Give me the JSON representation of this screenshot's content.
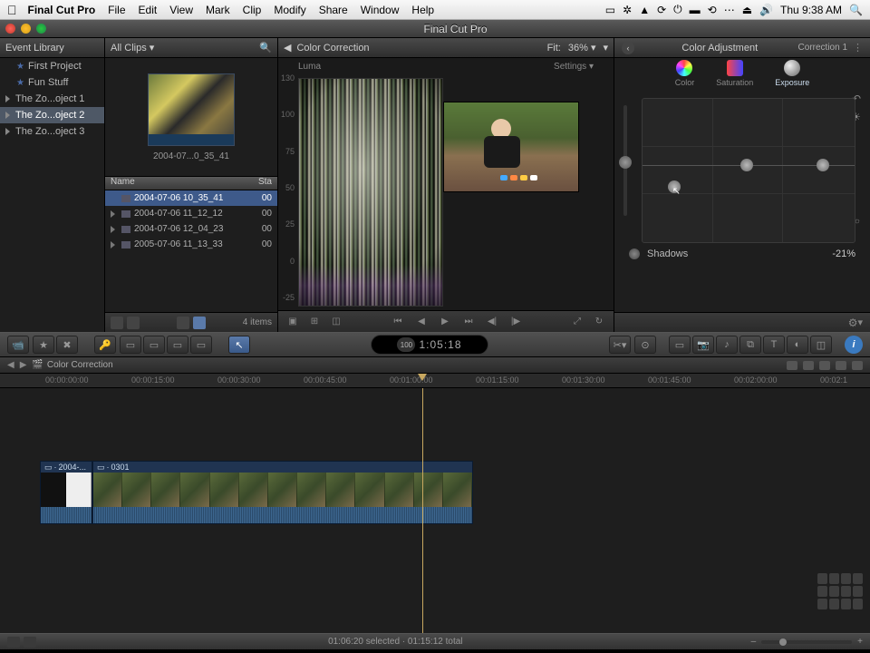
{
  "menubar": {
    "app": "Final Cut Pro",
    "items": [
      "File",
      "Edit",
      "View",
      "Mark",
      "Clip",
      "Modify",
      "Share",
      "Window",
      "Help"
    ],
    "clock": "Thu 9:38 AM"
  },
  "window_title": "Final Cut Pro",
  "event_library": {
    "title": "Event Library",
    "items": [
      {
        "label": "First Project",
        "kind": "star"
      },
      {
        "label": "Fun Stuff",
        "kind": "star"
      },
      {
        "label": "The Zo...oject 1",
        "kind": "tri"
      },
      {
        "label": "The Zo...oject 2",
        "kind": "tri",
        "selected": true
      },
      {
        "label": "The Zo...oject 3",
        "kind": "tri"
      }
    ]
  },
  "browser": {
    "filter": "All Clips",
    "thumb_label": "2004-07...0_35_41",
    "list_header": {
      "name": "Name",
      "start": "Sta"
    },
    "rows": [
      {
        "name": "2004-07-06 10_35_41",
        "start": "00",
        "selected": true
      },
      {
        "name": "2004-07-06 11_12_12",
        "start": "00"
      },
      {
        "name": "2004-07-06 12_04_23",
        "start": "00"
      },
      {
        "name": "2005-07-06 11_13_33",
        "start": "00"
      }
    ],
    "footer": "4 items"
  },
  "viewer": {
    "title": "Color Correction",
    "fit_label": "Fit:",
    "fit_value": "36%",
    "scope_label": "Luma",
    "settings_label": "Settings",
    "axis_ticks": [
      "130",
      "100",
      "75",
      "50",
      "25",
      "0",
      "-25"
    ]
  },
  "inspector": {
    "title": "Color Adjustment",
    "sub": "Correction 1",
    "tabs": {
      "color": "Color",
      "saturation": "Saturation",
      "exposure": "Exposure"
    },
    "param_label": "Shadows",
    "param_value": "-21%"
  },
  "timecode": {
    "badge": "100",
    "value": "1:05:18"
  },
  "timeline": {
    "title": "Color Correction",
    "ruler": [
      "00:00:00:00",
      "00:00:15:00",
      "00:00:30:00",
      "00:00:45:00",
      "00:01:00:00",
      "00:01:15:00",
      "00:01:30:00",
      "00:01:45:00",
      "00:02:00:00",
      "00:02:1"
    ],
    "clips": [
      {
        "label": "2004-..."
      },
      {
        "label": "0301"
      }
    ]
  },
  "statusbar": {
    "text": "01:06:20 selected · 01:15:12 total"
  }
}
